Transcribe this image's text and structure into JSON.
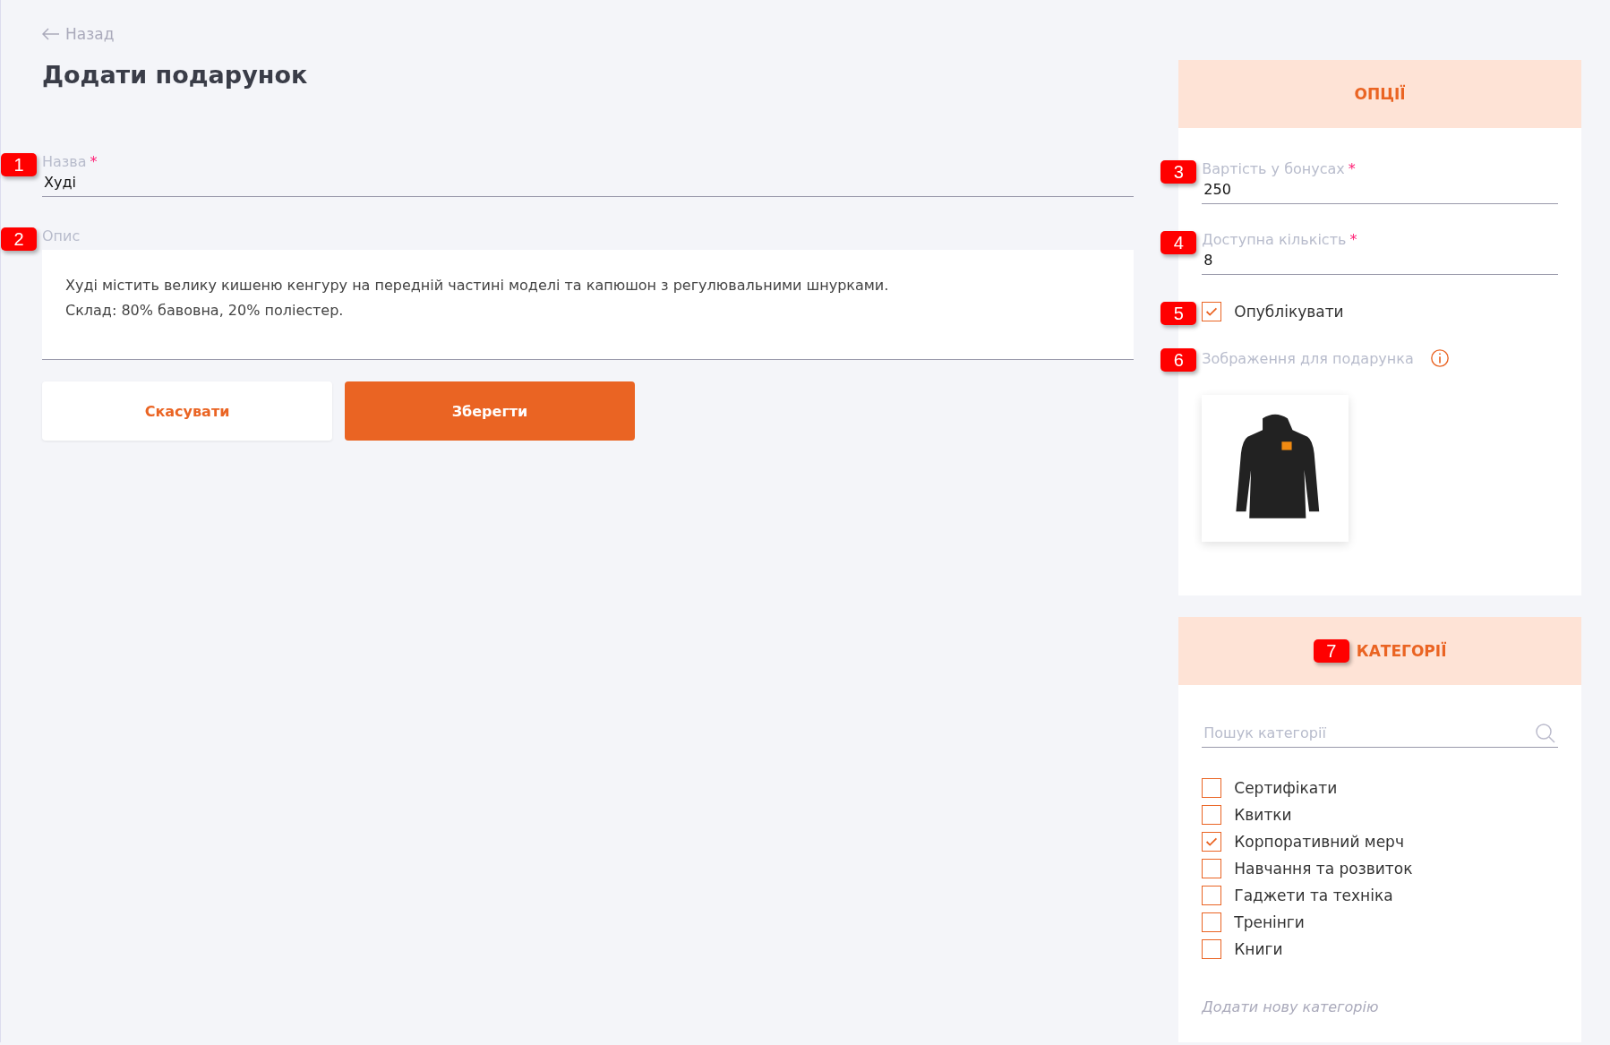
{
  "back_link": {
    "label": "Назад"
  },
  "title": "Додати подарунок",
  "name_field": {
    "marker": "1",
    "label": "Назва",
    "required_mark": "*",
    "value": "Худі"
  },
  "description_field": {
    "marker": "2",
    "label": "Опис",
    "value": "Худі містить велику кишеню кенгуру на передній частині моделі та капюшон з регулювальними шнурками.\nСклад: 80% бавовна, 20% поліестер."
  },
  "buttons": [
    {
      "label": "Скасувати",
      "kind": "secondary"
    },
    {
      "label": "Зберегти",
      "kind": "primary"
    }
  ],
  "options": {
    "title": "ОПЦІЇ",
    "fields": [
      {
        "marker": "3",
        "label": "Вартість у бонусах",
        "required_mark": "*",
        "value": "250"
      },
      {
        "marker": "4",
        "label": "Доступна кількість",
        "required_mark": "*",
        "value": "8"
      }
    ],
    "publish": {
      "marker": "5",
      "label": "Опублікувати",
      "checked": true
    },
    "image": {
      "marker": "6",
      "label": "Зображення для подарунка"
    }
  },
  "categories": {
    "marker": "7",
    "title": "КАТЕГОРІЇ",
    "search": {
      "placeholder": "Пошук категорії"
    },
    "items": [
      {
        "label": "Сертифікати",
        "checked": false
      },
      {
        "label": "Квитки",
        "checked": false
      },
      {
        "label": "Корпоративний мерч",
        "checked": true
      },
      {
        "label": "Навчання та розвиток",
        "checked": false
      },
      {
        "label": "Гаджети та техніка",
        "checked": false
      },
      {
        "label": "Тренінги",
        "checked": false
      },
      {
        "label": "Книги",
        "checked": false
      }
    ],
    "add_link": "Додати нову категорію"
  }
}
